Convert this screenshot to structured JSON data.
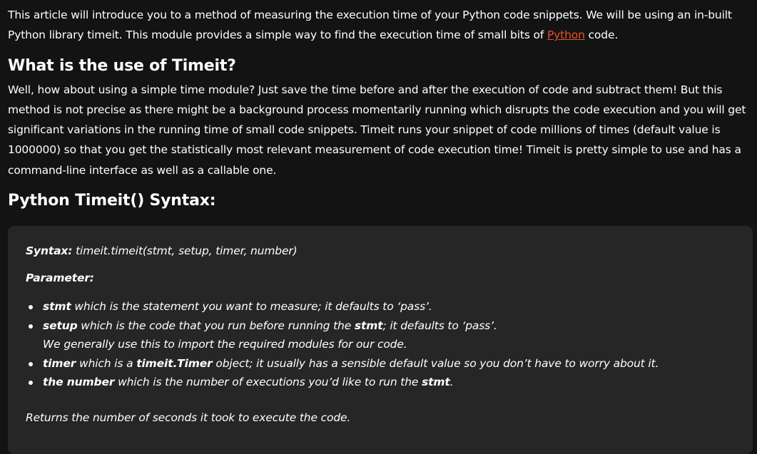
{
  "intro": {
    "text_before_link": "This article will introduce you to a method of measuring the execution time of your Python code snippets. We will be using an in-built Python library timeit. This module provides a simple way to find the execution time of small bits of ",
    "link_text": "Python",
    "text_after_link": " code."
  },
  "section_use": {
    "heading": "What is the use of Timeit?",
    "paragraph": "Well, how about using a simple time module? Just save the time before and after the execution of code and subtract them! But this method is not precise as there might be a background process momentarily running which disrupts the code execution and you will get significant variations in the running time of small code snippets. Timeit runs your snippet of code millions of times (default value is 1000000) so that you get the statistically most relevant measurement of code execution time! Timeit is pretty simple to use and has a command-line interface as well as a callable one."
  },
  "section_syntax": {
    "heading": "Python Timeit() Syntax:"
  },
  "syntax_box": {
    "syntax_label": "Syntax:",
    "syntax_value": " timeit.timeit(stmt, setup, timer, number)",
    "parameter_label": "Parameter:",
    "params": [
      {
        "name": "stmt",
        "desc": " which is the statement you want to measure; it defaults to ‘pass’."
      },
      {
        "name": "setup",
        "desc_part1": " which is the code that you run before running the ",
        "desc_bold": "stmt",
        "desc_part2": "; it defaults to ‘pass’.",
        "desc_line2": "We generally use this to import the required modules for our code."
      },
      {
        "name": "timer",
        "desc_part1": " which is a ",
        "desc_bold": "timeit.Timer",
        "desc_part2": " object; it usually has a sensible default value so you don’t have to worry about it."
      },
      {
        "name": "the number",
        "desc_part1": " which is the number of executions you’d like to run the ",
        "desc_bold": "stmt",
        "desc_part2": "."
      }
    ],
    "returns": "Returns the number of seconds it took to execute the code."
  }
}
